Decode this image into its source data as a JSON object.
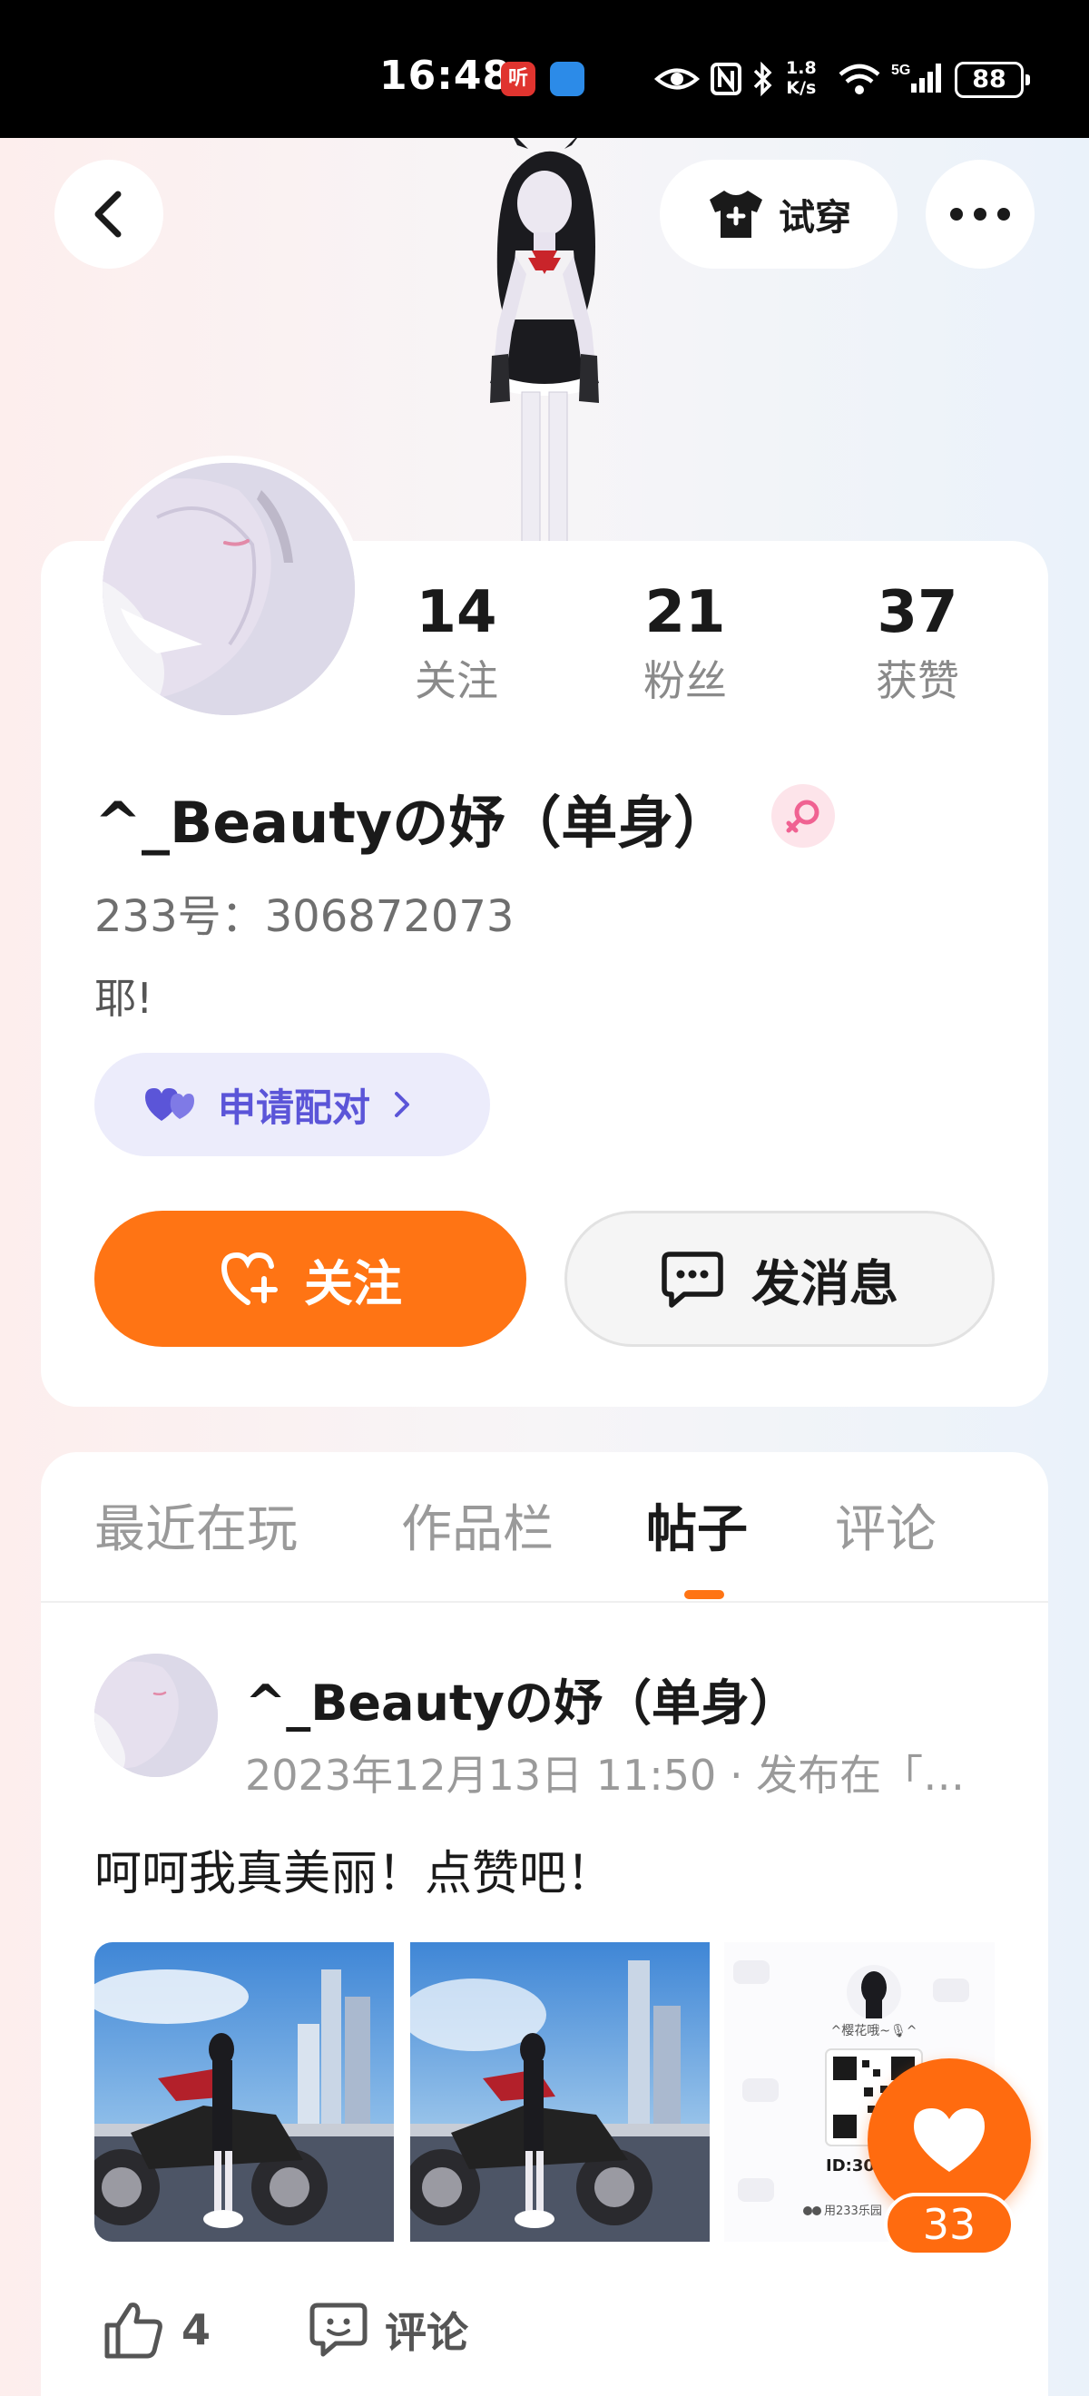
{
  "status_bar": {
    "time": "16:48",
    "app_badge": "听",
    "net_speed_value": "1.8",
    "net_speed_unit": "K/s",
    "network": "5G",
    "battery": "88"
  },
  "header": {
    "tryon_label": "试穿"
  },
  "profile": {
    "stats": [
      {
        "value": "14",
        "label": "关注"
      },
      {
        "value": "21",
        "label": "粉丝"
      },
      {
        "value": "37",
        "label": "获赞"
      }
    ],
    "username": "^_Beautyの妤（单身）",
    "gender": "female",
    "user_id": "233号：306872073",
    "bio": "耶!",
    "pair_label": "申请配对",
    "follow_label": "关注",
    "message_label": "发消息"
  },
  "tabs": [
    {
      "label": "最近在玩",
      "active": false
    },
    {
      "label": "作品栏",
      "active": false
    },
    {
      "label": "帖子",
      "active": true
    },
    {
      "label": "评论",
      "active": false
    }
  ],
  "post": {
    "author": "^_Beautyの妤（单身）",
    "meta": "2023年12月13日 11:50 · 发布在「…",
    "text": "呵呵我真美丽！点赞吧！",
    "image3_card": {
      "name": "^樱花哦~🎙^",
      "id_text": "ID:306",
      "footer": "用233乐园"
    },
    "likes": "4",
    "comment_label": "评论"
  },
  "floating_like": {
    "count": "33"
  },
  "colors": {
    "accent": "#ff7414",
    "pair_purple": "#5b55d8",
    "gender_pink": "#f06292"
  }
}
